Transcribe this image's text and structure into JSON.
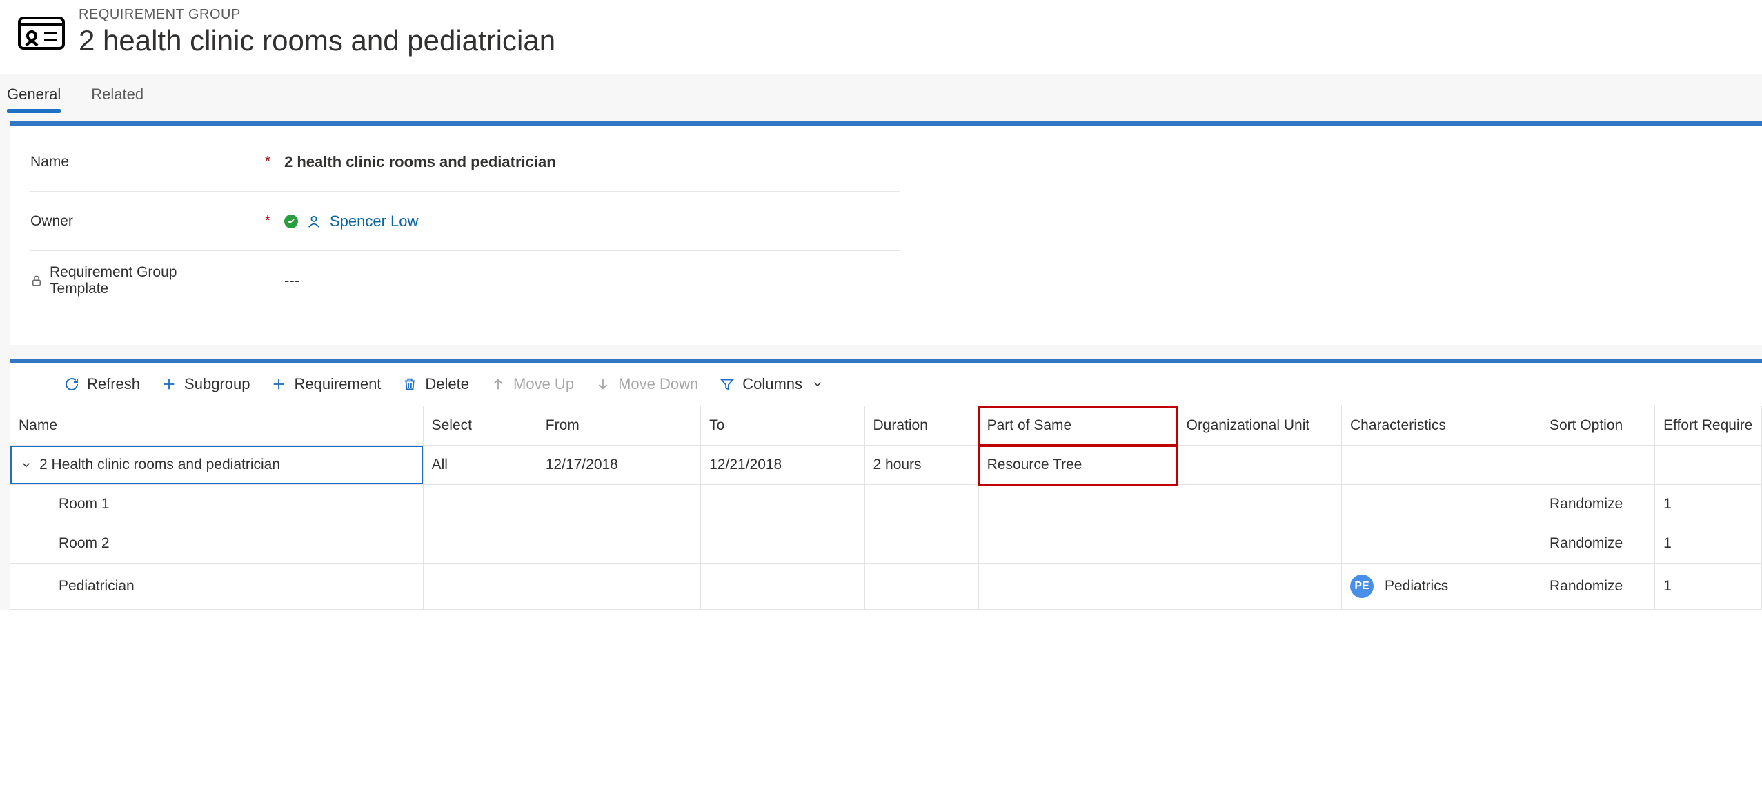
{
  "header": {
    "eyebrow": "REQUIREMENT GROUP",
    "title": "2 health clinic rooms and pediatrician"
  },
  "tabs": {
    "general": "General",
    "related": "Related"
  },
  "form": {
    "name_label": "Name",
    "name_value": "2 health clinic rooms and pediatrician",
    "owner_label": "Owner",
    "owner_value": "Spencer Low",
    "template_label": "Requirement Group Template",
    "template_value": "---"
  },
  "toolbar": {
    "refresh": "Refresh",
    "subgroup": "Subgroup",
    "requirement": "Requirement",
    "delete": "Delete",
    "moveup": "Move Up",
    "movedown": "Move Down",
    "columns": "Columns"
  },
  "grid": {
    "headers": {
      "name": "Name",
      "select": "Select",
      "from": "From",
      "to": "To",
      "duration": "Duration",
      "partofsame": "Part of Same",
      "orgunit": "Organizational Unit",
      "characteristics": "Characteristics",
      "sort": "Sort Option",
      "effort": "Effort Require"
    },
    "rows": [
      {
        "name": "2 Health clinic rooms and pediatrician",
        "select": "All",
        "from": "12/17/2018",
        "to": "12/21/2018",
        "duration": "2 hours",
        "partofsame": "Resource Tree",
        "orgunit": "",
        "char_badge": "",
        "char_text": "",
        "sort": "",
        "effort": ""
      },
      {
        "name": "Room 1",
        "select": "",
        "from": "",
        "to": "",
        "duration": "",
        "partofsame": "",
        "orgunit": "",
        "char_badge": "",
        "char_text": "",
        "sort": "Randomize",
        "effort": "1"
      },
      {
        "name": "Room 2",
        "select": "",
        "from": "",
        "to": "",
        "duration": "",
        "partofsame": "",
        "orgunit": "",
        "char_badge": "",
        "char_text": "",
        "sort": "Randomize",
        "effort": "1"
      },
      {
        "name": "Pediatrician",
        "select": "",
        "from": "",
        "to": "",
        "duration": "",
        "partofsame": "",
        "orgunit": "",
        "char_badge": "PE",
        "char_text": "Pediatrics",
        "sort": "Randomize",
        "effort": "1"
      }
    ]
  }
}
